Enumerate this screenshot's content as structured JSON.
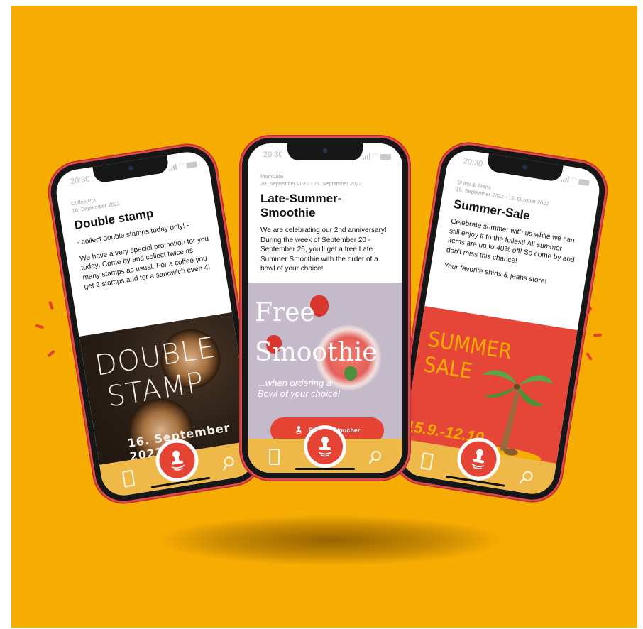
{
  "colors": {
    "background": "#f7ac02",
    "accent": "#e54333",
    "bottom_bar": "#efb949"
  },
  "phones": {
    "left": {
      "time": "20:30",
      "merchant": "Coffee Pot",
      "date": "16. September 2022",
      "title": "Double stamp",
      "paragraphs": [
        "- collect double stamps today only! -",
        "We have a very special promotion for you today! Come by and collect twice as many stamps as usual. For a coffee you get 2 stamps and for a sandwich even 4!"
      ],
      "art": {
        "line1": "DOUBLE",
        "line2": "STAMP",
        "date": "16. September 2022"
      }
    },
    "middle": {
      "time": "20:30",
      "merchant": "MainCafe",
      "date": "20. September 2022 - 26. September 2022",
      "title": "Late-Summer-Smoothie",
      "paragraphs": [
        "We are celebrating our 2nd anniversary! During the week of September 20 - September 26, you'll get a free Late Summer Smoothie with the order of a bowl of your choice!"
      ],
      "art": {
        "line1": "Free",
        "line2": "Smoothie",
        "sub1": "...when ordering a",
        "sub2": "Bowl of your choice!"
      },
      "redeem_label": "Redeem Voucher"
    },
    "right": {
      "time": "20:30",
      "merchant": "Shirts & Jeans",
      "date": "15. September 2022 - 12. October 2022",
      "title": "Summer-Sale",
      "paragraphs": [
        "Celebrate summer with us while we can still enjoy it to the fullest! All summer items are up to 40% off! So come by and don't miss this chance!",
        "Your favorite shirts & jeans store!"
      ],
      "art": {
        "line1": "SUMMER",
        "line2": "SALE",
        "dates": "15.9.-12.10."
      }
    }
  },
  "icons": {
    "stamp": "stamp-icon",
    "card": "loyalty-card-icon",
    "search": "search-icon",
    "wifi": "wifi-icon",
    "battery": "battery-icon"
  }
}
